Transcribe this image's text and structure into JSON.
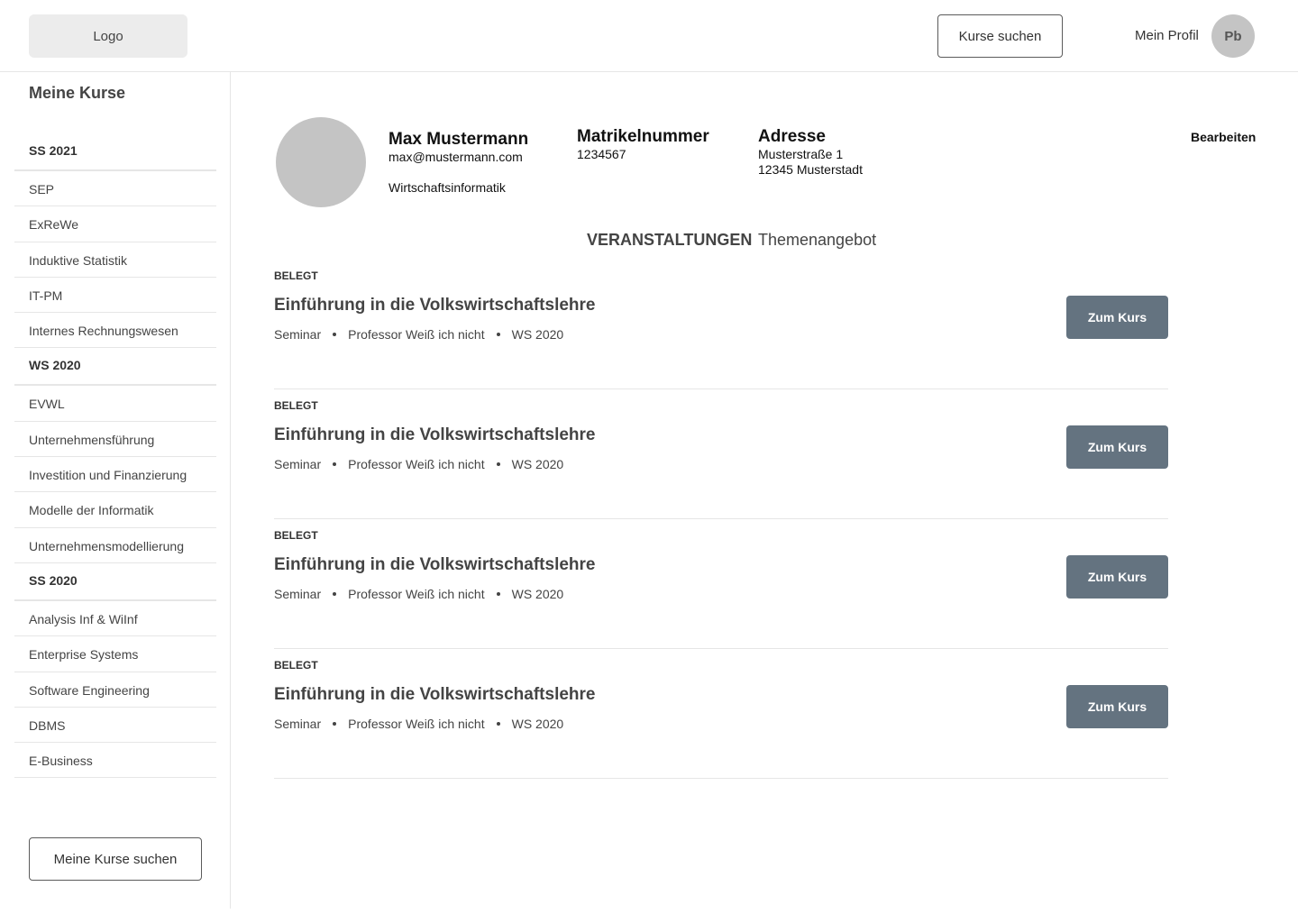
{
  "header": {
    "logo_label": "Logo",
    "search_courses_label": "Kurse suchen",
    "profile_label": "Mein Profil",
    "avatar_initials": "Pb"
  },
  "sidebar": {
    "title": "Meine Kurse",
    "sections": [
      {
        "label": "SS 2021",
        "items": [
          "SEP",
          "ExReWe",
          "Induktive Statistik",
          "IT-PM",
          "Internes Rechnungswesen"
        ]
      },
      {
        "label": "WS 2020",
        "items": [
          "EVWL",
          "Unternehmensführung",
          "Investition und Finanzierung",
          "Modelle der Informatik",
          "Unternehmensmodellierung"
        ]
      },
      {
        "label": "SS 2020",
        "items": [
          "Analysis Inf & WiInf",
          "Enterprise Systems",
          "Software Engineering",
          "DBMS",
          "E-Business"
        ]
      }
    ],
    "search_button_label": "Meine Kurse suchen"
  },
  "profile": {
    "name": "Max Mustermann",
    "email": "max@mustermann.com",
    "study_program": "Wirtschaftsinformatik",
    "matriculation_label": "Matrikelnummer",
    "matriculation_value": "1234567",
    "address_label": "Adresse",
    "address_line1": "Musterstraße 1",
    "address_line2": "12345 Musterstadt",
    "edit_label": "Bearbeiten"
  },
  "tabs": {
    "active": "VERANSTALTUNGEN",
    "inactive": "Themenangebot"
  },
  "courses": [
    {
      "status": "BELEGT",
      "title": "Einführung in die Volkswirtschaftslehre",
      "type": "Seminar",
      "professor": "Professor Weiß ich nicht",
      "semester": "WS 2020",
      "button": "Zum Kurs"
    },
    {
      "status": "BELEGT",
      "title": "Einführung in die Volkswirtschaftslehre",
      "type": "Seminar",
      "professor": "Professor Weiß ich nicht",
      "semester": "WS 2020",
      "button": "Zum Kurs"
    },
    {
      "status": "BELEGT",
      "title": "Einführung in die Volkswirtschaftslehre",
      "type": "Seminar",
      "professor": "Professor Weiß ich nicht",
      "semester": "WS 2020",
      "button": "Zum Kurs"
    },
    {
      "status": "BELEGT",
      "title": "Einführung in die Volkswirtschaftslehre",
      "type": "Seminar",
      "professor": "Professor Weiß ich nicht",
      "semester": "WS 2020",
      "button": "Zum Kurs"
    }
  ]
}
